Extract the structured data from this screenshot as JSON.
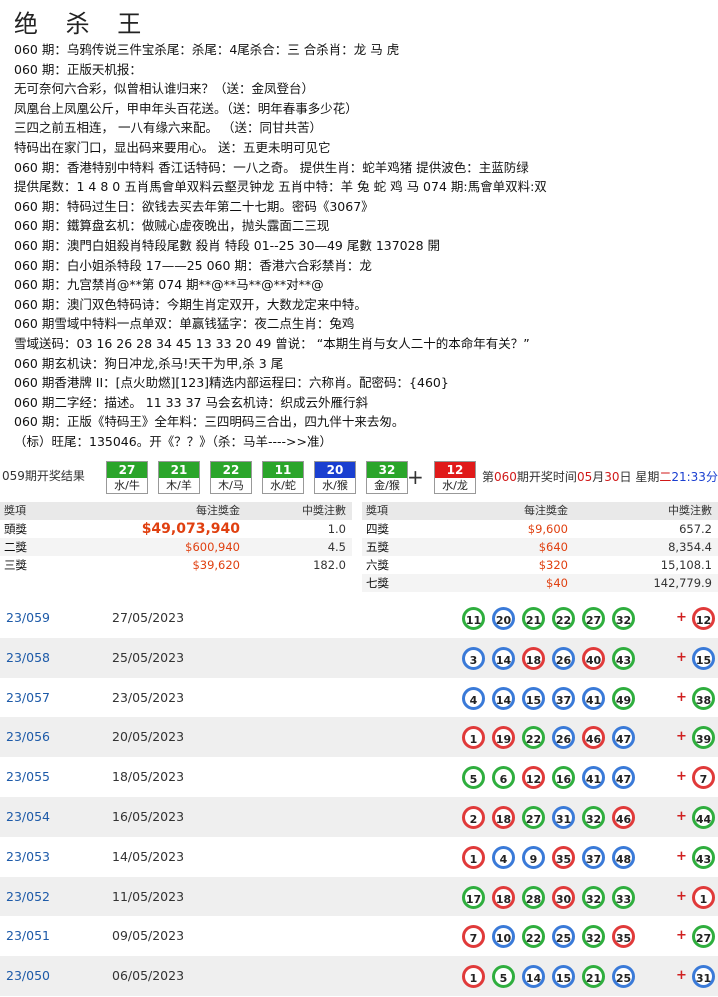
{
  "title": "绝 杀 王",
  "lines": [
    "060 期：乌鸦传说三件宝杀尾：杀尾：4尾杀合：三 合杀肖：龙 马 虎",
    "060 期：正版天机报：",
    "无可奈何六合彩，似曾相认谁归来？（送：金凤登台）",
    "凤凰台上凤凰公斤，甲申年头百花送。（送：明年春事多少花）",
    "三四之前五相连， 一八有缘六来配。  （送：同甘共苦）",
    "特码出在家门口，显出码来要用心。 送：五更未明可见它",
    "060 期：香港特别中特料  香江话特码：一八之奇。 提供生肖：蛇羊鸡猪 提供波色：主蓝防绿",
    "提供尾数：1 4 8 0  五肖馬會单双料云壑灵钟龙 五肖中特：羊 兔 蛇 鸡 马 074 期:馬會单双料:双",
    "060 期：特码过生日：欲钱去买去年第二十七期。密码《3067》",
    "060 期：鐵算盘玄机：做贼心虚夜晚出，抛头露面二三现",
    "060 期：澳門白姐殺肖特段尾數 殺肖  特段 01--25  30—49 尾數 137028 開",
    "060 期：白小姐杀特段 17——25           060 期：香港六合彩禁肖：龙",
    "060 期：九宫禁肖@**第 074 期**@**马**@**对**@",
    "060 期：澳门双色特码诗：今期生肖定双开，大数龙定来中特。",
    "060 期雪域中特料一点单双：单赢钱猛字：夜二点生肖：兔鸡",
    "雪域送码：03 16 26 28 34 45 13 33 20 49 曾说： “本期生肖与女人二十的本命年有关？”",
    "060 期玄机诀：狗日冲龙,杀马!天干为甲,杀 3 尾",
    "060 期香港牌 II：[点火助燃][123]精选内部运程曰：六称肖。配密码：{460}",
    "060 期二字经：描述。 11 33 37 马会玄机诗：织成云外雁行斜",
    "060 期：正版《特码王》全年料：三四明码三合出，四九伴十来去匆。",
    "（标）旺尾：135046。开《？？》（杀：马羊---->>准）"
  ],
  "draw": {
    "label": "059期开奖结果",
    "balls": [
      {
        "num": "27",
        "zodiac": "水/牛",
        "color": "#2aa52a"
      },
      {
        "num": "21",
        "zodiac": "木/羊",
        "color": "#2aa52a"
      },
      {
        "num": "22",
        "zodiac": "木/马",
        "color": "#2aa52a"
      },
      {
        "num": "11",
        "zodiac": "水/蛇",
        "color": "#2aa52a"
      },
      {
        "num": "20",
        "zodiac": "水/猴",
        "color": "#1a3fd0"
      },
      {
        "num": "32",
        "zodiac": "金/猴",
        "color": "#2aa52a"
      }
    ],
    "plus": "+",
    "special": {
      "num": "12",
      "zodiac": "水/龙",
      "color": "#e01a1a"
    },
    "info_prefix": "第",
    "info_issue": "060",
    "info_mid1": "期开奖时间",
    "info_month": "05",
    "info_mid2": "月",
    "info_day": "30",
    "info_mid3": "日  星期",
    "info_weekday": "二",
    "info_time": "21:33分"
  },
  "prize": {
    "headers": [
      "獎項",
      "每注獎金",
      "中獎注數",
      "獎項",
      "每注獎金",
      "中獎注數"
    ],
    "left": [
      {
        "name": "頭獎",
        "amount": "$49,073,940",
        "count": "1.0"
      },
      {
        "name": "二獎",
        "amount": "$600,940",
        "count": "4.5"
      },
      {
        "name": "三獎",
        "amount": "$39,620",
        "count": "182.0"
      }
    ],
    "right": [
      {
        "name": "四獎",
        "amount": "$9,600",
        "count": "657.2"
      },
      {
        "name": "五獎",
        "amount": "$640",
        "count": "8,354.4"
      },
      {
        "name": "六獎",
        "amount": "$320",
        "count": "15,108.1"
      },
      {
        "name": "七獎",
        "amount": "$40",
        "count": "142,779.9"
      }
    ]
  },
  "results": [
    {
      "id": "23/059",
      "date": "27/05/2023",
      "nums": [
        "11",
        "20",
        "21",
        "22",
        "27",
        "32"
      ],
      "colors": [
        "green",
        "blue",
        "green",
        "green",
        "green",
        "green"
      ],
      "special": "12",
      "special_color": "red"
    },
    {
      "id": "23/058",
      "date": "25/05/2023",
      "nums": [
        "3",
        "14",
        "18",
        "26",
        "40",
        "43"
      ],
      "colors": [
        "blue",
        "blue",
        "red",
        "blue",
        "red",
        "green"
      ],
      "special": "15",
      "special_color": "blue"
    },
    {
      "id": "23/057",
      "date": "23/05/2023",
      "nums": [
        "4",
        "14",
        "15",
        "37",
        "41",
        "49"
      ],
      "colors": [
        "blue",
        "blue",
        "blue",
        "blue",
        "blue",
        "green"
      ],
      "special": "38",
      "special_color": "green"
    },
    {
      "id": "23/056",
      "date": "20/05/2023",
      "nums": [
        "1",
        "19",
        "22",
        "26",
        "46",
        "47"
      ],
      "colors": [
        "red",
        "red",
        "green",
        "blue",
        "red",
        "blue"
      ],
      "special": "39",
      "special_color": "green"
    },
    {
      "id": "23/055",
      "date": "18/05/2023",
      "nums": [
        "5",
        "6",
        "12",
        "16",
        "41",
        "47"
      ],
      "colors": [
        "green",
        "green",
        "red",
        "green",
        "blue",
        "blue"
      ],
      "special": "7",
      "special_color": "red"
    },
    {
      "id": "23/054",
      "date": "16/05/2023",
      "nums": [
        "2",
        "18",
        "27",
        "31",
        "32",
        "46"
      ],
      "colors": [
        "red",
        "red",
        "green",
        "blue",
        "green",
        "red"
      ],
      "special": "44",
      "special_color": "green"
    },
    {
      "id": "23/053",
      "date": "14/05/2023",
      "nums": [
        "1",
        "4",
        "9",
        "35",
        "37",
        "48"
      ],
      "colors": [
        "red",
        "blue",
        "blue",
        "red",
        "blue",
        "blue"
      ],
      "special": "43",
      "special_color": "green"
    },
    {
      "id": "23/052",
      "date": "11/05/2023",
      "nums": [
        "17",
        "18",
        "28",
        "30",
        "32",
        "33"
      ],
      "colors": [
        "green",
        "red",
        "green",
        "red",
        "green",
        "green"
      ],
      "special": "1",
      "special_color": "red"
    },
    {
      "id": "23/051",
      "date": "09/05/2023",
      "nums": [
        "7",
        "10",
        "22",
        "25",
        "32",
        "35"
      ],
      "colors": [
        "red",
        "blue",
        "green",
        "blue",
        "green",
        "red"
      ],
      "special": "27",
      "special_color": "green"
    },
    {
      "id": "23/050",
      "date": "06/05/2023",
      "nums": [
        "1",
        "5",
        "14",
        "15",
        "21",
        "25"
      ],
      "colors": [
        "red",
        "green",
        "blue",
        "blue",
        "green",
        "blue"
      ],
      "special": "31",
      "special_color": "blue"
    }
  ]
}
